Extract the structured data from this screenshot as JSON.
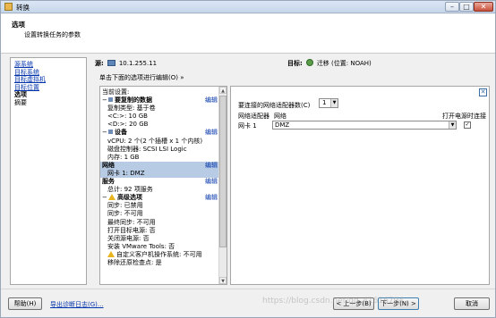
{
  "window": {
    "title": "转换"
  },
  "header": {
    "title": "选项",
    "subtitle": "设置转换任务的参数"
  },
  "nav": {
    "items": [
      {
        "label": "源系统",
        "type": "link"
      },
      {
        "label": "目标系统",
        "type": "link"
      },
      {
        "label": "目标虚拟机",
        "type": "link"
      },
      {
        "label": "目标位置",
        "type": "link"
      },
      {
        "label": "选项",
        "type": "current"
      },
      {
        "label": "摘要",
        "type": "plain"
      }
    ]
  },
  "source": {
    "label": "源:",
    "value": "10.1.255.11"
  },
  "target": {
    "label": "目标:",
    "value": "迁移 (位置: NOAH)"
  },
  "instruction": "单击下面的选项进行编辑(O) »",
  "tree": {
    "header": "当前设置:",
    "edit_label": "编辑",
    "copy_section": {
      "title": "要复制的数据",
      "lines": [
        "复制类型: 基于卷",
        "<C:>: 10 GB",
        "<D:>: 20 GB"
      ]
    },
    "device_section": {
      "title": "设备",
      "lines": [
        "vCPU: 2 个(2 个插槽 x 1 个内核)",
        "磁盘控制器: SCSI LSI Logic",
        "内存: 1 GB"
      ]
    },
    "network_section": {
      "title": "网络",
      "lines": [
        "网卡 1: DMZ"
      ]
    },
    "service_section": {
      "title": "服务",
      "lines": [
        "总计: 92 项服务"
      ]
    },
    "advanced_section": {
      "title": "高级选项",
      "lines": [
        "同步: 已禁用",
        "同步: 不可用",
        "最终同步: 不可用",
        "打开目标电源: 否",
        "关闭源电源: 否",
        "安装 VMware Tools: 否"
      ],
      "warn_line": "自定义客户机操作系统: 不可用",
      "last_line": "移除还原检查点: 是"
    }
  },
  "netpanel": {
    "count_label": "要连接的网络适配器数(C)",
    "count_value": "1",
    "columns": {
      "adapter": "网络适配器",
      "network": "网络",
      "connect": "打开电源时连接"
    },
    "rows": [
      {
        "adapter": "网卡 1",
        "network": "DMZ",
        "connect_checked": true
      }
    ]
  },
  "footer": {
    "help": "帮助(H)",
    "diag": "导出诊断日志(G)...",
    "back": "< 上一步(B)",
    "next": "下一步(N) >",
    "cancel": "取消",
    "watermark": "https://blog.csdn.net/qq_41616794"
  }
}
